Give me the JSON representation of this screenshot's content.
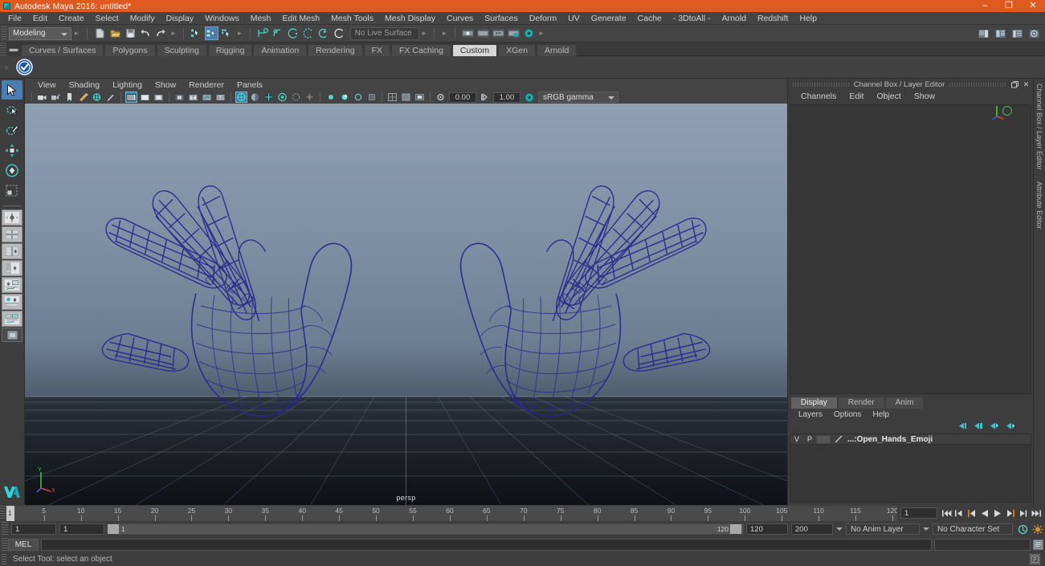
{
  "window": {
    "title": "Autodesk Maya 2016: untitled*",
    "app_icon": "maya-icon",
    "controls": {
      "minimize": "–",
      "maximize": "❐",
      "close": "✕"
    },
    "titlebar_color": "#e05a1f"
  },
  "menubar": {
    "items": [
      "File",
      "Edit",
      "Create",
      "Select",
      "Modify",
      "Display",
      "Windows",
      "Mesh",
      "Edit Mesh",
      "Mesh Tools",
      "Mesh Display",
      "Curves",
      "Surfaces",
      "Deform",
      "UV",
      "Generate",
      "Cache",
      "- 3DtoAll -",
      "Arnold",
      "Redshift",
      "Help"
    ]
  },
  "statusline": {
    "mode_menu": "Modeling",
    "live_surface": "No Live Surface",
    "file_icons": [
      "new-scene-icon",
      "open-scene-icon",
      "save-scene-icon",
      "undo-icon",
      "redo-icon"
    ],
    "selection_mask_icons": [
      "select-by-hierarchy-icon",
      "select-by-object-type-icon",
      "select-by-component-type-icon"
    ],
    "snap_icons": [
      "snap-to-grid-icon",
      "snap-to-curve-icon",
      "snap-to-point-icon",
      "snap-to-projected-center-icon",
      "snap-to-view-plane-icon",
      "make-live-icon"
    ],
    "render_icons": [
      "render-current-frame-icon",
      "render-sequence-icon",
      "ipr-render-icon",
      "render-settings-icon",
      "hypershade-icon"
    ],
    "editor_icons": [
      "show-hide-attribute-editor-icon",
      "show-hide-tool-settings-icon",
      "show-hide-channel-box-icon",
      "toggle-icon"
    ]
  },
  "shelf": {
    "tabs": [
      "Curves / Surfaces",
      "Polygons",
      "Sculpting",
      "Rigging",
      "Animation",
      "Rendering",
      "FX",
      "FX Caching",
      "Custom",
      "XGen",
      "Arnold"
    ],
    "active_tab": "Custom",
    "items": [
      "check-badge-icon"
    ]
  },
  "toolbox": {
    "tools": [
      {
        "name": "select-tool",
        "active": true
      },
      {
        "name": "lasso-select-tool",
        "active": false
      },
      {
        "name": "paint-select-tool",
        "active": false
      },
      {
        "name": "move-tool",
        "active": false
      },
      {
        "name": "rotate-tool",
        "active": false
      },
      {
        "name": "scale-tool",
        "active": false
      }
    ],
    "layouts": [
      {
        "name": "single-perspective-view-layout"
      },
      {
        "name": "four-view-layout"
      },
      {
        "name": "two-pane-side-by-side-layout"
      },
      {
        "name": "outliner-persp-layout"
      },
      {
        "name": "persp-graph-layout"
      },
      {
        "name": "hypershade-persp-layout"
      },
      {
        "name": "persp-render-layout"
      },
      {
        "name": "single-pane-layout"
      }
    ],
    "logo": "maya-logo-icon"
  },
  "viewport": {
    "menus": [
      "View",
      "Shading",
      "Lighting",
      "Show",
      "Renderer",
      "Panels"
    ],
    "camera_label": "persp",
    "exposure_value": "0.00",
    "gamma_value": "1.00",
    "color_management": "sRGB gamma",
    "icon_groups": {
      "cameras": [
        "select-camera-icon",
        "lock-camera-icon",
        "bookmark-icon",
        "image-plane-icon",
        "two-d-pan-zoom-icon",
        "grease-pencil-icon"
      ],
      "display": [
        "resolution-gate-icon",
        "film-gate-icon",
        "field-chart-icon",
        "safe-action-icon",
        "safe-title-icon"
      ],
      "panels": [
        "isolate-select-icon",
        "xray-icon",
        "xray-joints-icon",
        "text-icon"
      ],
      "shading": [
        "wireframe-icon",
        "smooth-shade-icon",
        "shaded-wireframe-icon",
        "hardware-texturing-icon",
        "use-default-lighting-icon",
        "shadows-icon",
        "screen-space-ao-icon",
        "motion-blur-icon",
        "multisample-aa-icon",
        "depth-of-field-icon"
      ],
      "lights": [
        "all-lights-icon",
        "default-light-icon",
        "scene-lights-icon",
        "shadow-icon"
      ],
      "overlays": [
        "grid-icon",
        "film-gate-overlay-icon",
        "gate-mask-icon"
      ],
      "exposure_gamma": [
        "exposure-icon",
        "gamma-icon",
        "color-management-icon"
      ]
    },
    "scene": {
      "object_name": "Open_Hands_Emoji",
      "display_mode": "wireframe",
      "wireframe_color": "#2b2f9e",
      "background_top": "#8fa0b2",
      "background_bottom": "#151a20"
    },
    "axis_gizmo": {
      "y_label": "Y",
      "x_label": "X",
      "z_label": "Z"
    }
  },
  "channel_box": {
    "panel_title": "Channel Box / Layer Editor",
    "menus": [
      "Channels",
      "Edit",
      "Object",
      "Show"
    ],
    "buttons": [
      "undock-icon",
      "close-icon"
    ],
    "contents": []
  },
  "layer_editor": {
    "tabs": [
      "Display",
      "Render",
      "Anim"
    ],
    "active_tab": "Display",
    "menus": [
      "Layers",
      "Options",
      "Help"
    ],
    "toolbar_icons": [
      "new-layer-icon",
      "new-layer-from-selected-icon",
      "select-objects-in-layer-icon",
      "add-selected-objects-icon"
    ],
    "layers": [
      {
        "visibility": "V",
        "playback": "P",
        "color_swatch": "#9a9a9a",
        "name": "...:Open_Hands_Emoji"
      }
    ]
  },
  "timeline": {
    "start_frame": "1",
    "end_frame": "120",
    "current_frame": "1",
    "ticks": [
      5,
      10,
      15,
      20,
      25,
      30,
      35,
      40,
      45,
      50,
      55,
      60,
      65,
      70,
      75,
      80,
      85,
      90,
      95,
      100,
      105,
      110,
      115,
      120
    ],
    "playback_buttons": [
      "go-to-start-icon",
      "step-back-keyframe-icon",
      "step-back-frame-icon",
      "play-backwards-icon",
      "play-forwards-icon",
      "step-forward-frame-icon",
      "step-forward-keyframe-icon",
      "go-to-end-icon"
    ]
  },
  "range_slider": {
    "range_start": "1",
    "range_end": "1",
    "anim_start": "120",
    "anim_end": "200",
    "bar_start_label": "1",
    "bar_end_label": "120",
    "anim_layer": "No Anim Layer",
    "character_set": "No Character Set",
    "right_icons": [
      "auto-keyframe-icon",
      "animation-preferences-icon"
    ]
  },
  "command_line": {
    "language_label": "MEL",
    "input_value": "",
    "script_editor_icon": "script-editor-icon"
  },
  "help_line": {
    "message": "Select Tool: select an object",
    "icon": "help-icon"
  }
}
